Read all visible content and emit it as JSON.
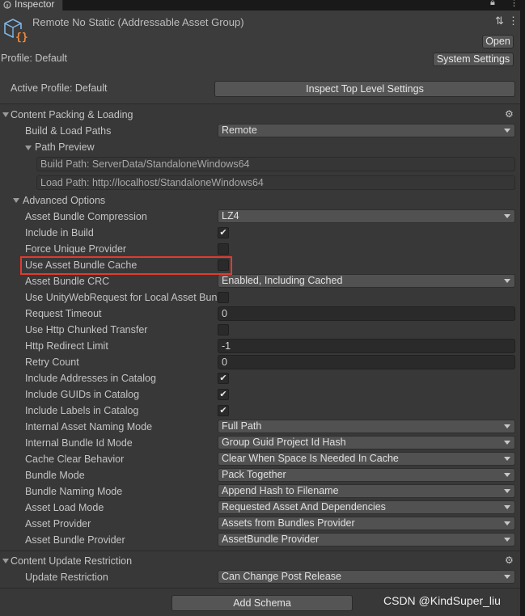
{
  "tab": {
    "label": "Inspector"
  },
  "header": {
    "title": "Remote No Static (Addressable Asset Group)",
    "open_button": "Open",
    "profile_label": "Profile: Default",
    "system_settings_button": "System Settings"
  },
  "active_profile": {
    "label": "Active Profile: Default",
    "inspect_button": "Inspect Top Level Settings"
  },
  "content_packing": {
    "section_title": "Content Packing & Loading",
    "build_load_paths": {
      "label": "Build & Load Paths",
      "value": "Remote"
    },
    "path_preview": {
      "title": "Path Preview",
      "build_path": "Build Path: ServerData/StandaloneWindows64",
      "load_path": "Load Path: http://localhost/StandaloneWindows64"
    },
    "advanced": {
      "title": "Advanced Options",
      "rows": [
        {
          "label": "Asset Bundle Compression",
          "type": "dropdown",
          "value": "LZ4"
        },
        {
          "label": "Include in Build",
          "type": "checkbox",
          "checked": true
        },
        {
          "label": "Force Unique Provider",
          "type": "checkbox",
          "checked": false
        },
        {
          "label": "Use Asset Bundle Cache",
          "type": "checkbox",
          "checked": false,
          "highlighted": true
        },
        {
          "label": "Asset Bundle CRC",
          "type": "dropdown",
          "value": "Enabled, Including Cached"
        },
        {
          "label": "Use UnityWebRequest for Local Asset Bundles",
          "type": "checkbox",
          "checked": false
        },
        {
          "label": "Request Timeout",
          "type": "field",
          "value": "0"
        },
        {
          "label": "Use Http Chunked Transfer",
          "type": "checkbox",
          "checked": false
        },
        {
          "label": "Http Redirect Limit",
          "type": "field",
          "value": "-1"
        },
        {
          "label": "Retry Count",
          "type": "field",
          "value": "0"
        },
        {
          "label": "Include Addresses in Catalog",
          "type": "checkbox",
          "checked": true
        },
        {
          "label": "Include GUIDs in Catalog",
          "type": "checkbox",
          "checked": true
        },
        {
          "label": "Include Labels in Catalog",
          "type": "checkbox",
          "checked": true
        },
        {
          "label": "Internal Asset Naming Mode",
          "type": "dropdown",
          "value": "Full Path"
        },
        {
          "label": "Internal Bundle Id Mode",
          "type": "dropdown",
          "value": "Group Guid Project Id Hash"
        },
        {
          "label": "Cache Clear Behavior",
          "type": "dropdown",
          "value": "Clear When Space Is Needed In Cache"
        },
        {
          "label": "Bundle Mode",
          "type": "dropdown",
          "value": "Pack Together"
        },
        {
          "label": "Bundle Naming Mode",
          "type": "dropdown",
          "value": "Append Hash to Filename"
        },
        {
          "label": "Asset Load Mode",
          "type": "dropdown",
          "value": "Requested Asset And Dependencies"
        },
        {
          "label": "Asset Provider",
          "type": "dropdown",
          "value": "Assets from Bundles Provider"
        },
        {
          "label": "Asset Bundle Provider",
          "type": "dropdown",
          "value": "AssetBundle Provider"
        }
      ]
    }
  },
  "content_update": {
    "section_title": "Content Update Restriction",
    "update_restriction": {
      "label": "Update Restriction",
      "value": "Can Change Post Release"
    }
  },
  "add_schema_button": "Add Schema",
  "watermark": "CSDN @KindSuper_liu",
  "icons": {
    "tab": "inspector-icon",
    "asset": "addressable-group-icon",
    "lock": "lock-icon",
    "menu": "kebab-menu-icon",
    "layout": "layout-icon",
    "help": "help-icon",
    "gear": "gear-icon",
    "foldout": "foldout-arrow-icon",
    "dropdown": "dropdown-arrow-icon",
    "checkmark": "checkmark-icon"
  },
  "colors": {
    "panel_background": "#383838",
    "header_background": "#3c3c3c",
    "highlight_box": "#e23a2f",
    "field_background": "#2a2a2a"
  }
}
